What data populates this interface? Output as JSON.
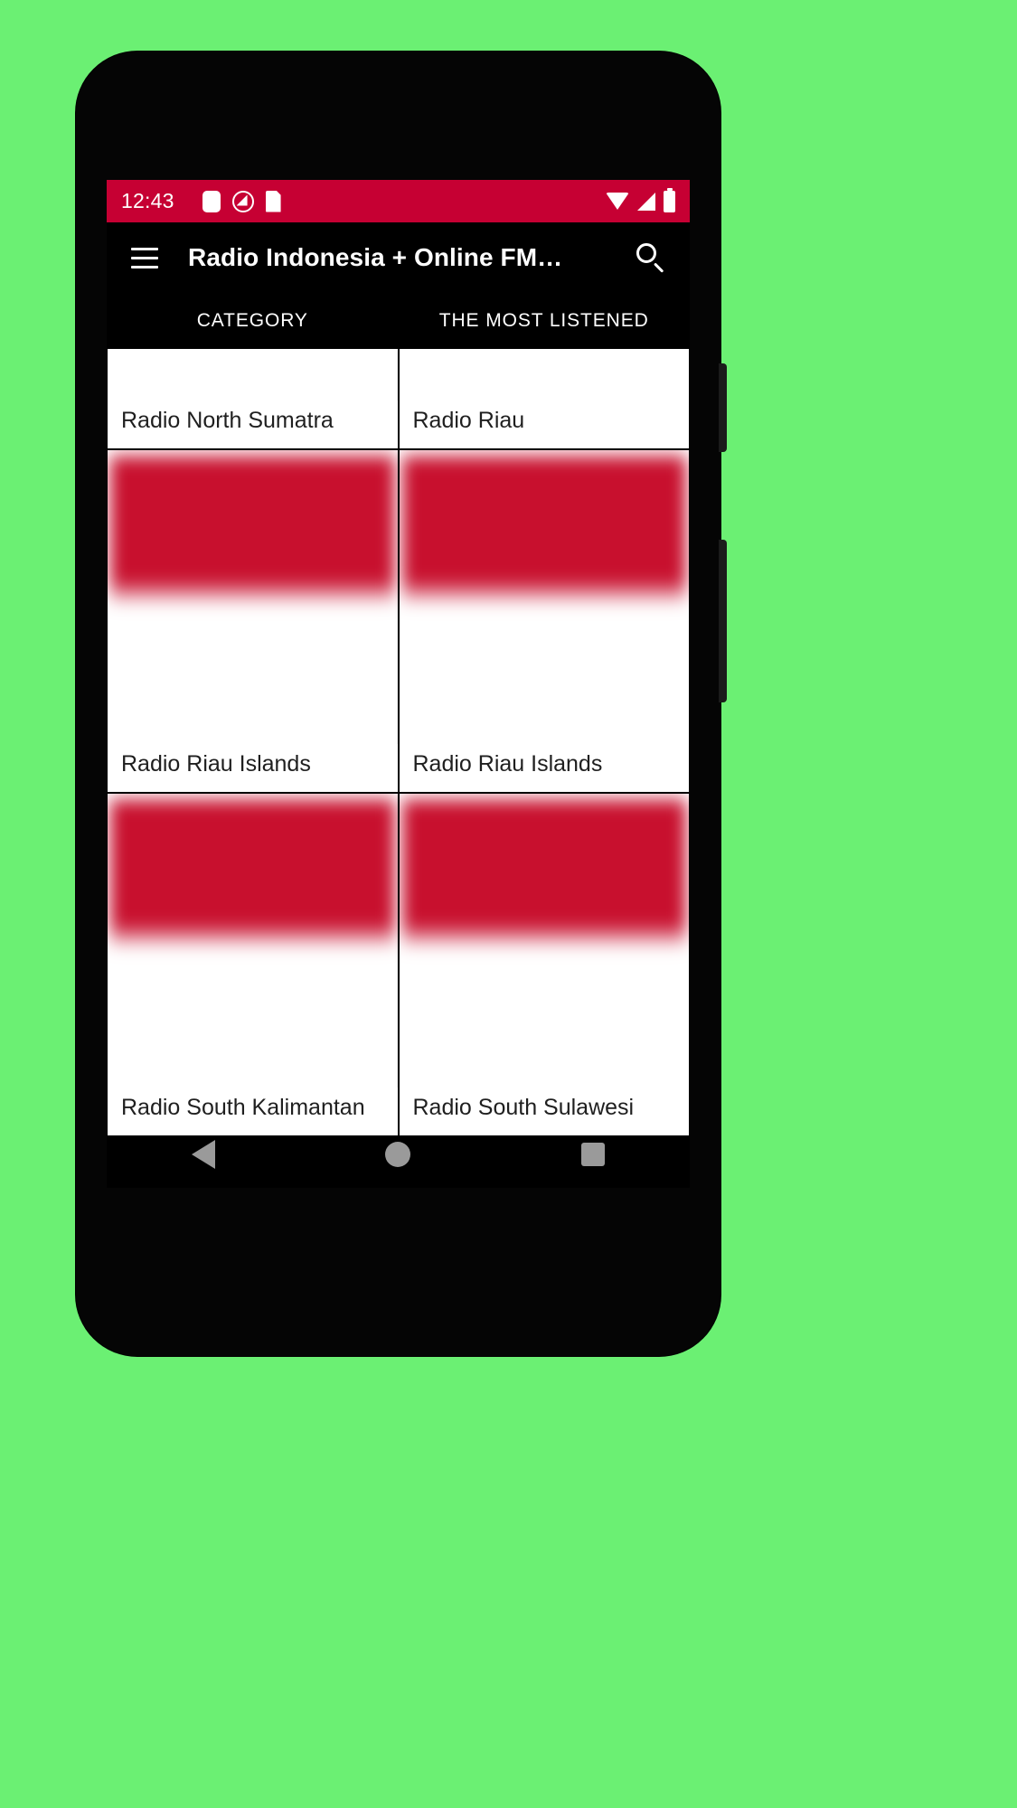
{
  "statusbar": {
    "time": "12:43",
    "left_icons": [
      "screenshot-icon",
      "no-sound-icon",
      "sd-card-icon"
    ],
    "right_icons": [
      "wifi-icon",
      "cellular-signal-icon",
      "battery-icon"
    ],
    "background_color": "#c60033"
  },
  "appbar": {
    "menu_label": "menu-icon",
    "title": "Radio Indonesia + Online FM…",
    "search_label": "search-icon",
    "background_color": "#000000"
  },
  "tabs": [
    {
      "label": "CATEGORY",
      "selected": true
    },
    {
      "label": "THE MOST LISTENED",
      "selected": false
    }
  ],
  "grid": {
    "rows": [
      {
        "type": "partial",
        "cards": [
          {
            "label": "Radio North Sumatra"
          },
          {
            "label": "Radio Riau"
          }
        ]
      },
      {
        "type": "full",
        "cards": [
          {
            "label": "Radio Riau Islands"
          },
          {
            "label": "Radio Riau Islands"
          }
        ]
      },
      {
        "type": "full",
        "cards": [
          {
            "label": "Radio South Kalimantan"
          },
          {
            "label": "Radio South Sulawesi"
          }
        ]
      }
    ]
  },
  "navbar": {
    "back_label": "back-triangle-icon",
    "home_label": "home-circle-icon",
    "recents_label": "recents-square-icon"
  },
  "theme": {
    "page_background": "#6bf073",
    "flag_red": "#c8102e",
    "flag_white": "#ffffff",
    "device_body": "#050505"
  }
}
